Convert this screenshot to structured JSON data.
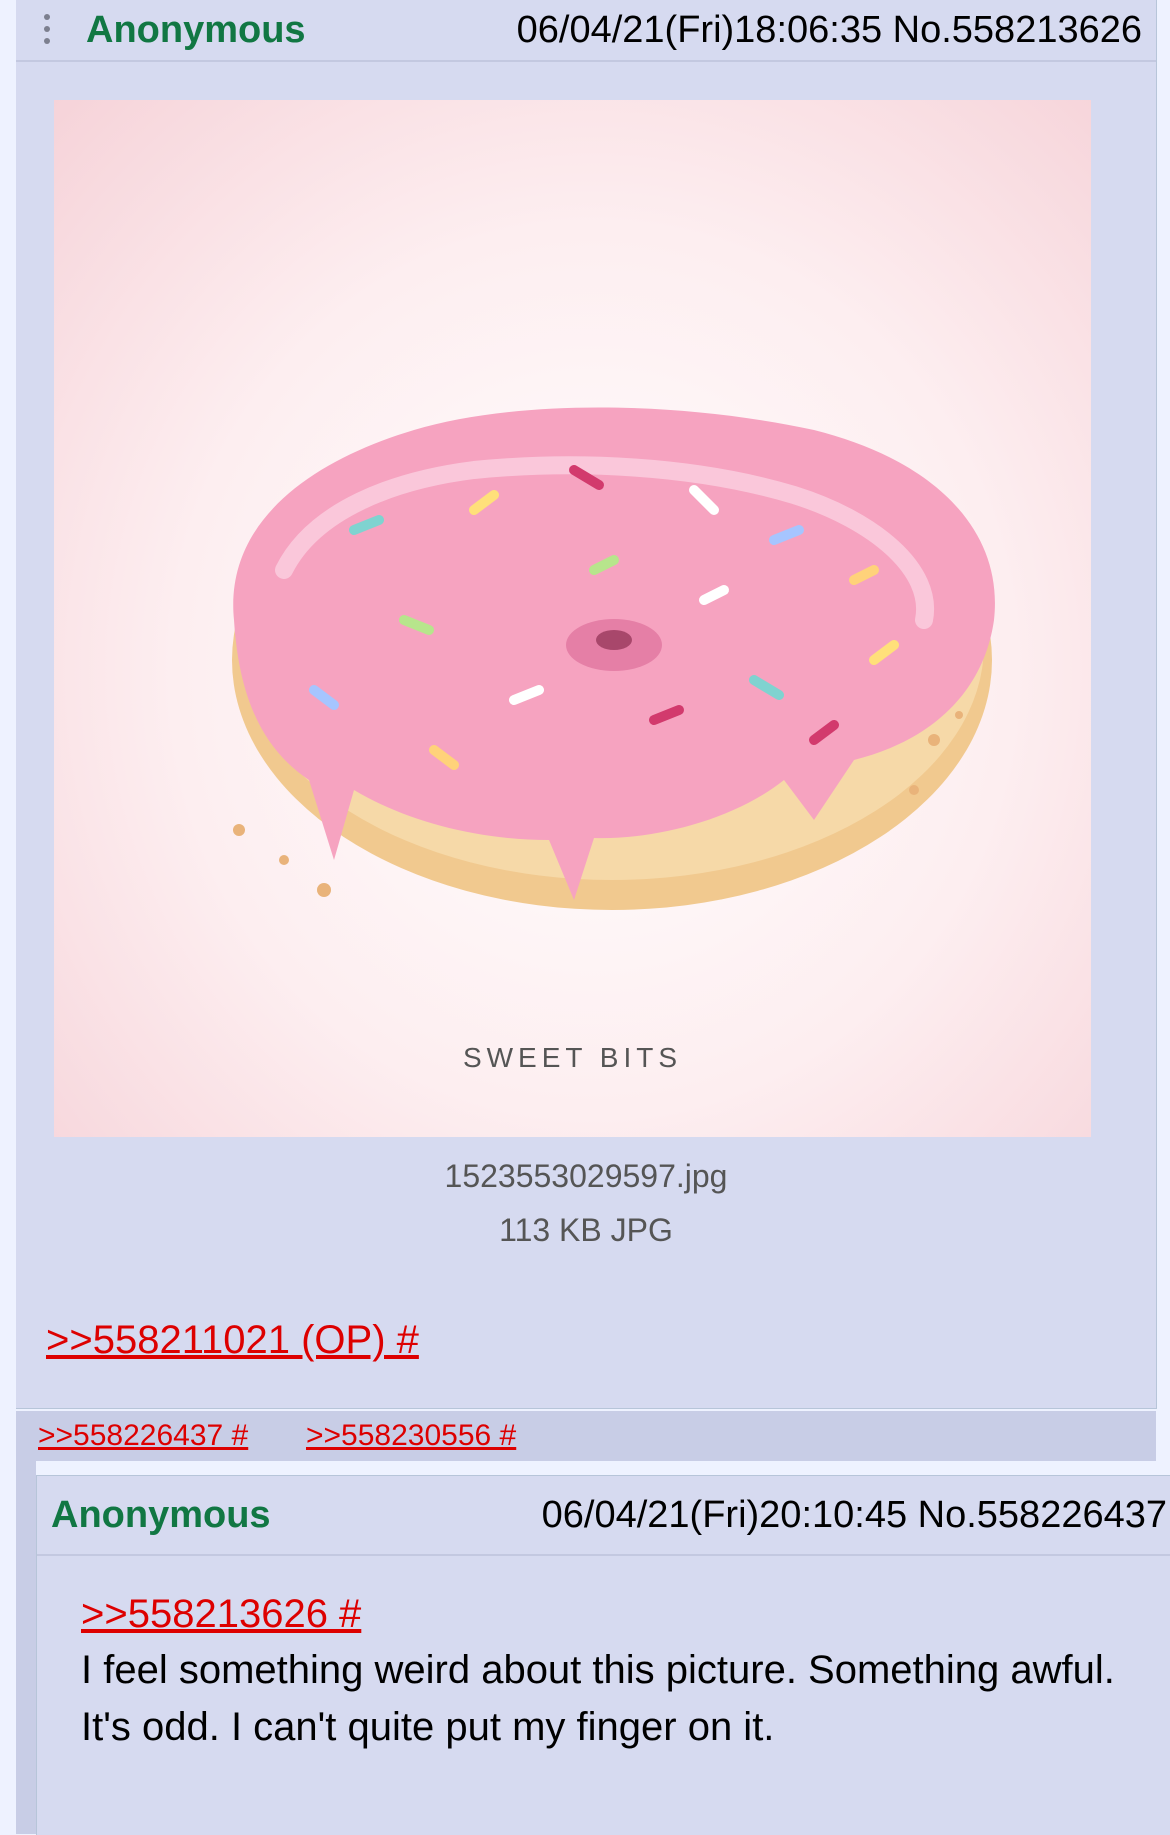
{
  "post1": {
    "name": "Anonymous",
    "datetime": "06/04/21(Fri)18:06:35",
    "post_no": "No.558213626",
    "image_text": "SWEET BITS",
    "file_name": "1523553029597.jpg",
    "file_info": "113 KB JPG",
    "quote_link": ">>558211021 (OP) #"
  },
  "replies": [
    ">>558226437 #",
    ">>558230556 #"
  ],
  "post2": {
    "name": "Anonymous",
    "datetime": "06/04/21(Fri)20:10:45",
    "post_no": "No.558226437",
    "quote_link": ">>558213626 #",
    "message": "I feel something weird about this picture. Something awful. It's odd. I can't quite put my finger on it."
  },
  "colors": {
    "post_bg": "#d6daf0",
    "name": "#117743",
    "quote_link": "#dd0000",
    "icing": "#f6a3c0",
    "dough": "#f1c98f"
  },
  "icons": [
    "menu-dots-icon"
  ]
}
